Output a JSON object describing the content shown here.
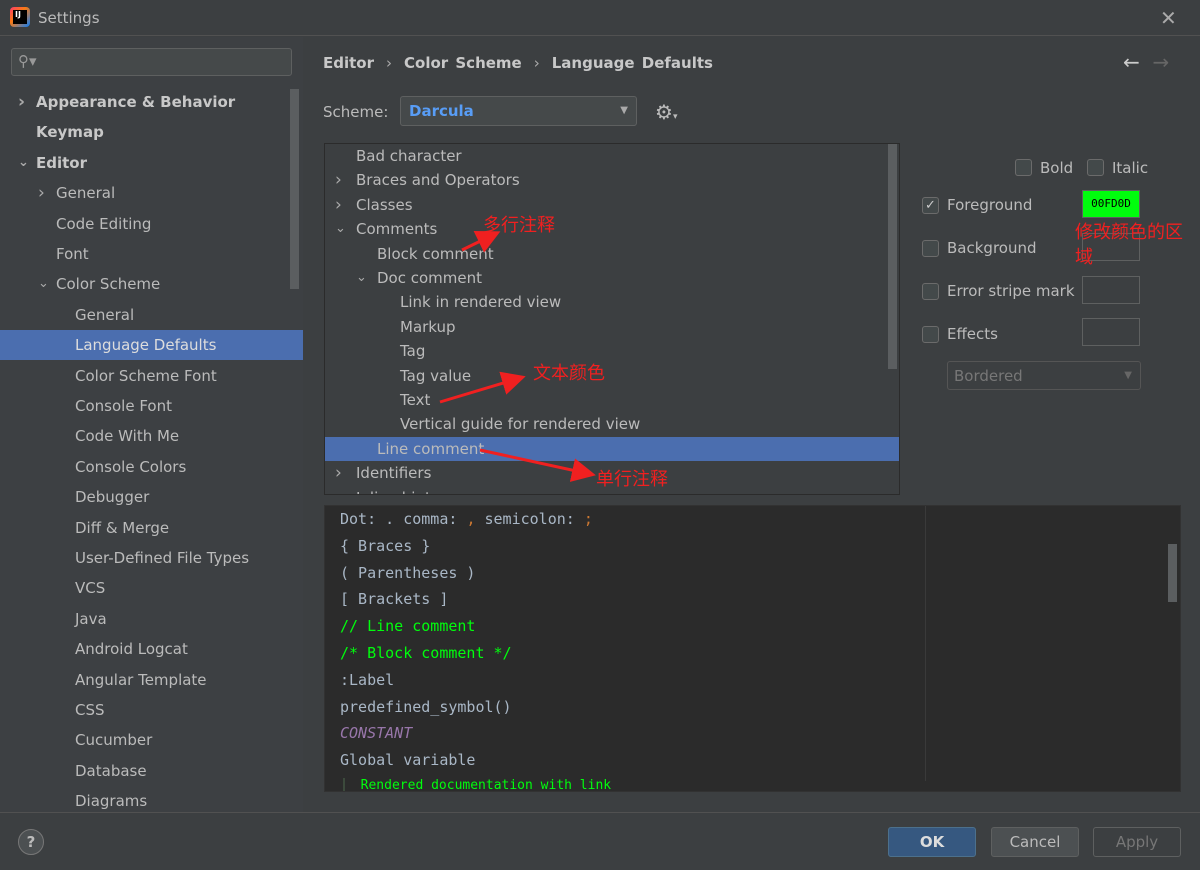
{
  "window": {
    "title": "Settings",
    "close_icon": "close-icon"
  },
  "sidebar": {
    "search_placeholder": "",
    "items": [
      {
        "label": "Appearance & Behavior",
        "level": 0,
        "expander": "collapsed",
        "bold": true
      },
      {
        "label": "Keymap",
        "level": 0,
        "bold": true
      },
      {
        "label": "Editor",
        "level": 0,
        "expander": "expanded",
        "bold": true
      },
      {
        "label": "General",
        "level": 1,
        "expander": "collapsed"
      },
      {
        "label": "Code Editing",
        "level": 1
      },
      {
        "label": "Font",
        "level": 1
      },
      {
        "label": "Color Scheme",
        "level": 1,
        "expander": "expanded"
      },
      {
        "label": "General",
        "level": 2
      },
      {
        "label": "Language Defaults",
        "level": 2,
        "selected": true
      },
      {
        "label": "Color Scheme Font",
        "level": 2
      },
      {
        "label": "Console Font",
        "level": 2
      },
      {
        "label": "Code With Me",
        "level": 2
      },
      {
        "label": "Console Colors",
        "level": 2
      },
      {
        "label": "Debugger",
        "level": 2
      },
      {
        "label": "Diff & Merge",
        "level": 2
      },
      {
        "label": "User-Defined File Types",
        "level": 2
      },
      {
        "label": "VCS",
        "level": 2
      },
      {
        "label": "Java",
        "level": 2
      },
      {
        "label": "Android Logcat",
        "level": 2
      },
      {
        "label": "Angular Template",
        "level": 2
      },
      {
        "label": "CSS",
        "level": 2
      },
      {
        "label": "Cucumber",
        "level": 2
      },
      {
        "label": "Database",
        "level": 2
      },
      {
        "label": "Diagrams",
        "level": 2
      }
    ]
  },
  "breadcrumb": [
    "Editor",
    "Color Scheme",
    "Language Defaults"
  ],
  "scheme": {
    "label": "Scheme:",
    "value": "Darcula"
  },
  "tree": [
    {
      "label": "Bad character",
      "level": 0
    },
    {
      "label": "Braces and Operators",
      "level": 0,
      "expander": "collapsed"
    },
    {
      "label": "Classes",
      "level": 0,
      "expander": "collapsed"
    },
    {
      "label": "Comments",
      "level": 0,
      "expander": "expanded"
    },
    {
      "label": "Block comment",
      "level": 1
    },
    {
      "label": "Doc comment",
      "level": 1,
      "expander": "expanded"
    },
    {
      "label": "Link in rendered view",
      "level": 2
    },
    {
      "label": "Markup",
      "level": 2
    },
    {
      "label": "Tag",
      "level": 2
    },
    {
      "label": "Tag value",
      "level": 2
    },
    {
      "label": "Text",
      "level": 2
    },
    {
      "label": "Vertical guide for rendered view",
      "level": 2
    },
    {
      "label": "Line comment",
      "level": 1,
      "selected": true
    },
    {
      "label": "Identifiers",
      "level": 0,
      "expander": "collapsed"
    },
    {
      "label": "Inline hints",
      "level": 0,
      "expander": "collapsed"
    }
  ],
  "options": {
    "bold": {
      "label": "Bold",
      "checked": false
    },
    "italic": {
      "label": "Italic",
      "checked": false
    },
    "foreground": {
      "label": "Foreground",
      "checked": true,
      "color": "00FD0D"
    },
    "background": {
      "label": "Background",
      "checked": false
    },
    "error_stripe": {
      "label": "Error stripe mark",
      "checked": false
    },
    "effects": {
      "label": "Effects",
      "checked": false,
      "type": "Bordered"
    }
  },
  "preview": [
    {
      "text": "Dot: . comma: , semicolon: ;",
      "color": "#a9b7c6"
    },
    {
      "text": "{ Braces }",
      "color": "#a9b7c6"
    },
    {
      "text": "( Parentheses )",
      "color": "#a9b7c6"
    },
    {
      "text": "[ Brackets ]",
      "color": "#a9b7c6"
    },
    {
      "text": "// Line comment",
      "color": "#00fd0d"
    },
    {
      "text": "/* Block comment */",
      "color": "#00fd0d"
    },
    {
      "text": ":Label",
      "color": "#a9b7c6"
    },
    {
      "text": "predefined_symbol()",
      "color": "#a9b7c6"
    },
    {
      "text": "CONSTANT",
      "color": "#9876aa",
      "italic": true
    },
    {
      "text": "Global variable",
      "color": "#a9b7c6"
    },
    {
      "text": "  Rendered documentation with link",
      "color": "#00fd0d"
    }
  ],
  "buttons": {
    "ok": "OK",
    "cancel": "Cancel",
    "apply": "Apply",
    "help": "?"
  },
  "annotations": {
    "multiline": "多行注释",
    "color_area": "修改颜色的区域",
    "text_color": "文本颜色",
    "single_line": "单行注释"
  },
  "colors": {
    "accent": "#4b6eaf",
    "annotation": "#f02020",
    "comment_fg": "#00fd0d"
  }
}
